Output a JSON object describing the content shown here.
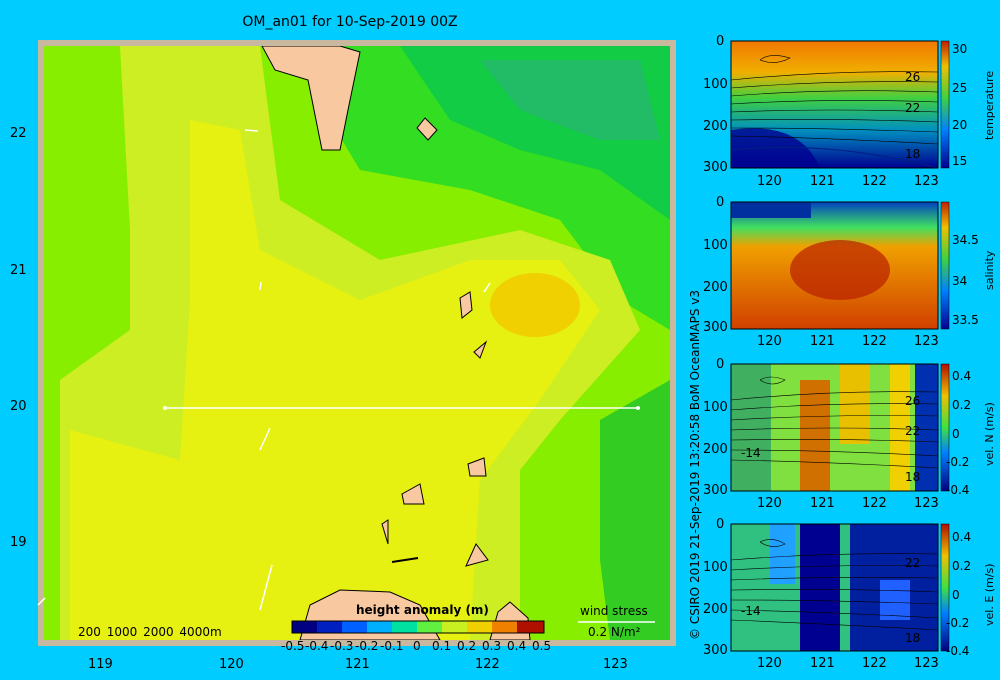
{
  "title": "OM_an01 for 10-Sep-2019 00Z",
  "map": {
    "x_ticks": [
      "119",
      "120",
      "121",
      "122",
      "123"
    ],
    "y_ticks": [
      "22",
      "21",
      "20",
      "19"
    ],
    "depth_legend": "200  1000  2000  4000m",
    "wind_stress_label": "wind stress",
    "wind_stress_scale": "0.2 N/m²",
    "colorbar_title": "height anomaly  (m)",
    "colorbar_ticks": [
      "-0.5",
      "-0.4",
      "-0.3",
      "-0.2",
      "-0.1",
      "0",
      "0.1",
      "0.2",
      "0.3",
      "0.4",
      "0.5"
    ]
  },
  "credit": "© CSIRO 2019   21-Sep-2019 13:20:58 BoM OceanMAPS v3",
  "sections": {
    "x_ticks": [
      "120",
      "121",
      "122",
      "123"
    ],
    "y_ticks": [
      "0",
      "100",
      "200",
      "300"
    ],
    "panels": [
      {
        "name": "temperature",
        "label": "temperature",
        "cb_ticks": [
          "30",
          "25",
          "20",
          "15"
        ],
        "contours": [
          "26",
          "22",
          "18",
          "18"
        ]
      },
      {
        "name": "salinity",
        "label": "salinity",
        "cb_ticks": [
          "34.5",
          "34",
          "33.5"
        ],
        "contours": []
      },
      {
        "name": "vel-n",
        "label": "vel. N (m/s)",
        "cb_ticks": [
          "0.4",
          "0.2",
          "0",
          "-0.2",
          "-0.4"
        ],
        "contours": [
          "26",
          "22",
          "-14",
          "18"
        ]
      },
      {
        "name": "vel-e",
        "label": "vel. E (m/s)",
        "cb_ticks": [
          "0.4",
          "0.2",
          "0",
          "-0.2",
          "-0.4"
        ],
        "contours": [
          "22",
          "-14",
          "18"
        ]
      }
    ]
  }
}
